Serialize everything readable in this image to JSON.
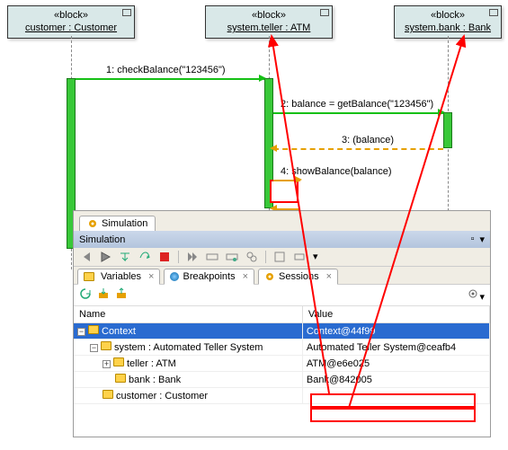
{
  "lifelines": {
    "customer": {
      "stereotype": "«block»",
      "name": "customer : Customer"
    },
    "atm": {
      "stereotype": "«block»",
      "name": "system.teller : ATM"
    },
    "bank": {
      "stereotype": "«block»",
      "name": "system.bank : Bank"
    }
  },
  "messages": {
    "m1": "1: checkBalance(\"123456\")",
    "m2": "2: balance = getBalance(\"123456\")",
    "m3": "3: (balance)",
    "m4": "4: showBalance(balance)"
  },
  "sim": {
    "tab_label": "Simulation",
    "title": "Simulation",
    "subtabs": {
      "variables": "Variables",
      "breakpoints": "Breakpoints",
      "sessions": "Sessions"
    },
    "columns": {
      "name": "Name",
      "value": "Value"
    },
    "rows": {
      "context": {
        "name": "Context",
        "value": "Context@44f99"
      },
      "system": {
        "name": "system : Automated Teller System",
        "value": "Automated Teller System@ceafb4"
      },
      "teller": {
        "name": "teller : ATM",
        "value": "ATM@e6e025"
      },
      "bank": {
        "name": "bank : Bank",
        "value": "Bank@842005"
      },
      "customer": {
        "name": "customer : Customer",
        "value": ""
      }
    }
  },
  "chart_data": {
    "type": "sequence-diagram",
    "lifelines": [
      {
        "id": "customer",
        "stereotype": "block",
        "label": "customer : Customer"
      },
      {
        "id": "atm",
        "stereotype": "block",
        "label": "system.teller : ATM"
      },
      {
        "id": "bank",
        "stereotype": "block",
        "label": "system.bank : Bank"
      }
    ],
    "messages": [
      {
        "seq": 1,
        "from": "customer",
        "to": "atm",
        "kind": "sync",
        "label": "checkBalance(\"123456\")"
      },
      {
        "seq": 2,
        "from": "atm",
        "to": "bank",
        "kind": "sync",
        "label": "balance = getBalance(\"123456\")"
      },
      {
        "seq": 3,
        "from": "bank",
        "to": "atm",
        "kind": "return",
        "label": "(balance)"
      },
      {
        "seq": 4,
        "from": "atm",
        "to": "atm",
        "kind": "self",
        "label": "showBalance(balance)",
        "highlight": "current"
      }
    ],
    "simulation_bindings": [
      {
        "variable": "teller : ATM",
        "value": "ATM@e6e025",
        "refers_to_lifeline": "atm"
      },
      {
        "variable": "bank : Bank",
        "value": "Bank@842005",
        "refers_to_lifeline": "bank"
      }
    ]
  }
}
